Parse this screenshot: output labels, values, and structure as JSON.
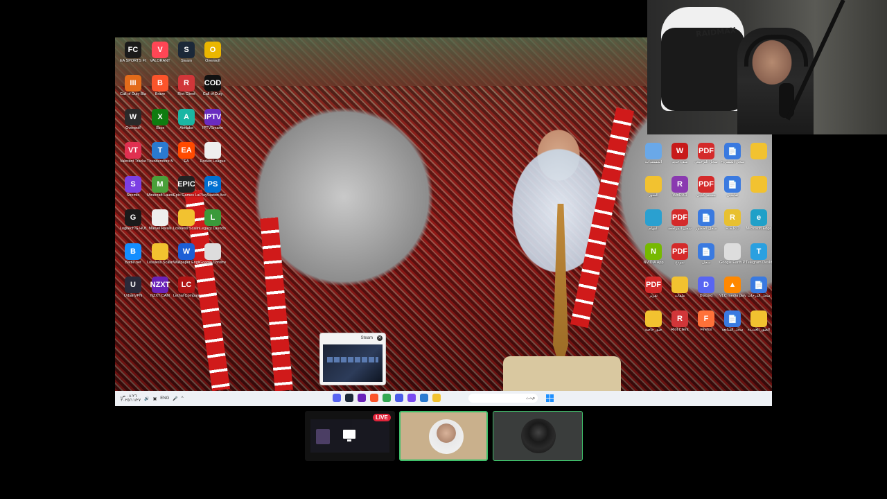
{
  "desktop": {
    "icons_left": [
      {
        "label": "EA SPORTS FC™ 26",
        "color": "#1a1a1a",
        "glyph": "FC"
      },
      {
        "label": "VALORANT",
        "color": "#ff4655",
        "glyph": "V"
      },
      {
        "label": "Steam",
        "color": "#1b2838",
        "glyph": "S"
      },
      {
        "label": "Overwolf",
        "color": "#eab600",
        "glyph": "O"
      },
      {
        "label": "Call of Duty Black Ops III",
        "color": "#e36b1a",
        "glyph": "III"
      },
      {
        "label": "Brave",
        "color": "#fb542b",
        "glyph": "B"
      },
      {
        "label": "Riot Client",
        "color": "#d13639",
        "glyph": "R"
      },
      {
        "label": "Call of Duty",
        "color": "#111111",
        "glyph": "COD"
      },
      {
        "label": "Overwolf",
        "color": "#2a2a2a",
        "glyph": "W"
      },
      {
        "label": "Xbox",
        "color": "#107c10",
        "glyph": "X"
      },
      {
        "label": "Aimlabs",
        "color": "#1bb6a4",
        "glyph": "A"
      },
      {
        "label": "IPTVSmarte",
        "color": "#6a2cc0",
        "glyph": "IPTV"
      },
      {
        "label": "Valorant Tracker",
        "color": "#e03050",
        "glyph": "VT"
      },
      {
        "label": "Thunderstore Mod Manager",
        "color": "#2a7ad0",
        "glyph": "T"
      },
      {
        "label": "EA",
        "color": "#ff4a00",
        "glyph": "EA"
      },
      {
        "label": "Rocket League",
        "color": "#eeeeee",
        "glyph": ""
      },
      {
        "label": "Stremio",
        "color": "#7b3fe4",
        "glyph": "S"
      },
      {
        "label": "Minecraft Launcher",
        "color": "#4aa03a",
        "glyph": "M"
      },
      {
        "label": "Epic Games Launcher",
        "color": "#222222",
        "glyph": "EPIC"
      },
      {
        "label": "PlayStation Accessories",
        "color": "#0070d1",
        "glyph": "PS"
      },
      {
        "label": "Logitech G HUB",
        "color": "#1a1a1a",
        "glyph": "G"
      },
      {
        "label": "Marvel Rivals",
        "color": "#eeeeee",
        "glyph": ""
      },
      {
        "label": "Lossless Scaling",
        "color": "#f2c230",
        "glyph": ""
      },
      {
        "label": "Legacy Launcher",
        "color": "#3a9a3a",
        "glyph": "L"
      },
      {
        "label": "Battle.net",
        "color": "#148eff",
        "glyph": "B"
      },
      {
        "label": "Lossless Scaling",
        "color": "#f2c230",
        "glyph": ""
      },
      {
        "label": "Wallpaper Engine",
        "color": "#1c5fd6",
        "glyph": "W"
      },
      {
        "label": "Google Chrome",
        "color": "#dddddd",
        "glyph": ""
      },
      {
        "label": "UrbanVPN",
        "color": "#2a2a3a",
        "glyph": "U"
      },
      {
        "label": "NZXT CAM",
        "color": "#6a22b8",
        "glyph": "NZXT"
      },
      {
        "label": "Lethal Company",
        "color": "#b01515",
        "glyph": "LC"
      }
    ],
    "icons_right": [
      {
        "label": "المستندات",
        "color": "#6aa8e8",
        "glyph": ""
      },
      {
        "label": "ملف جديد",
        "color": "#c81a1a",
        "glyph": "W"
      },
      {
        "label": "سجل الترخيص",
        "color": "#d42a2a",
        "glyph": "PDF"
      },
      {
        "label": "سجل المشروع",
        "color": "#3a7ae0",
        "glyph": "📄"
      },
      {
        "label": "",
        "color": "#f2c230",
        "glyph": ""
      },
      {
        "label": "الصور",
        "color": "#f2c230",
        "glyph": ""
      },
      {
        "label": "WinRAR",
        "color": "#8a3ab0",
        "glyph": "R"
      },
      {
        "label": "مستند كتابي",
        "color": "#d42a2a",
        "glyph": "PDF"
      },
      {
        "label": "تفاصيل",
        "color": "#3a7ae0",
        "glyph": "📄"
      },
      {
        "label": "",
        "color": "#f2c230",
        "glyph": ""
      },
      {
        "label": "المهام",
        "color": "#2aa0d0",
        "glyph": ""
      },
      {
        "label": "سجل المراجعة",
        "color": "#d42a2a",
        "glyph": "PDF"
      },
      {
        "label": "سجل الحضور",
        "color": "#3a7ae0",
        "glyph": "📄"
      },
      {
        "label": "R.E.P.O",
        "color": "#e8c030",
        "glyph": "R"
      },
      {
        "label": "Microsoft Edge",
        "color": "#1fa0c8",
        "glyph": "e"
      },
      {
        "label": "NVIDIA App",
        "color": "#76b900",
        "glyph": "N"
      },
      {
        "label": "نموذج",
        "color": "#d42a2a",
        "glyph": "PDF"
      },
      {
        "label": "سجل",
        "color": "#3a7ae0",
        "glyph": "📄"
      },
      {
        "label": "Google Earth Pro",
        "color": "#dddddd",
        "glyph": ""
      },
      {
        "label": "Telegram Desktop",
        "color": "#2aa0e0",
        "glyph": "T"
      },
      {
        "label": "تقرير",
        "color": "#d42a2a",
        "glyph": "PDF"
      },
      {
        "label": "ملفات",
        "color": "#f2c230",
        "glyph": ""
      },
      {
        "label": "Discord",
        "color": "#5865f2",
        "glyph": "D"
      },
      {
        "label": "VLC media player",
        "color": "#ff8800",
        "glyph": "▲"
      },
      {
        "label": "سجل الدرجات",
        "color": "#3a7ae0",
        "glyph": "📄"
      },
      {
        "label": "صور خاصة",
        "color": "#f2c230",
        "glyph": ""
      },
      {
        "label": "Riot Client",
        "color": "#d13639",
        "glyph": "R"
      },
      {
        "label": "Firefox",
        "color": "#ff7139",
        "glyph": "F"
      },
      {
        "label": "سجل المتابعة",
        "color": "#3a7ae0",
        "glyph": "📄"
      },
      {
        "label": "الصور الجديدة",
        "color": "#f2c230",
        "glyph": ""
      }
    ]
  },
  "steam_preview": {
    "title": "Steam",
    "close_glyph": "✕"
  },
  "taskbar": {
    "time": "٠٨:٢٦ ص",
    "date": "٢٠٢٥/١١/٢٧",
    "lang": "ENG",
    "chevron": "^",
    "search_placeholder": "بحث",
    "search_icon": "⌕",
    "apps": [
      {
        "name": "discord-taskbar-icon",
        "color": "#5865f2"
      },
      {
        "name": "steam-taskbar-icon",
        "color": "#1b2838"
      },
      {
        "name": "nzxt-taskbar-icon",
        "color": "#6a22b8"
      },
      {
        "name": "brave-taskbar-icon",
        "color": "#fb542b"
      },
      {
        "name": "chrome-taskbar-icon",
        "color": "#34a853"
      },
      {
        "name": "app-taskbar-icon",
        "color": "#4a5ae8"
      },
      {
        "name": "messenger-taskbar-icon",
        "color": "#7a4af0"
      },
      {
        "name": "store-taskbar-icon",
        "color": "#2a7ad0"
      },
      {
        "name": "explorer-taskbar-icon",
        "color": "#f2c230"
      }
    ]
  },
  "webcam": {
    "chair_brand": "RAIDMAX"
  },
  "participants": {
    "live_badge": "LIVE"
  }
}
